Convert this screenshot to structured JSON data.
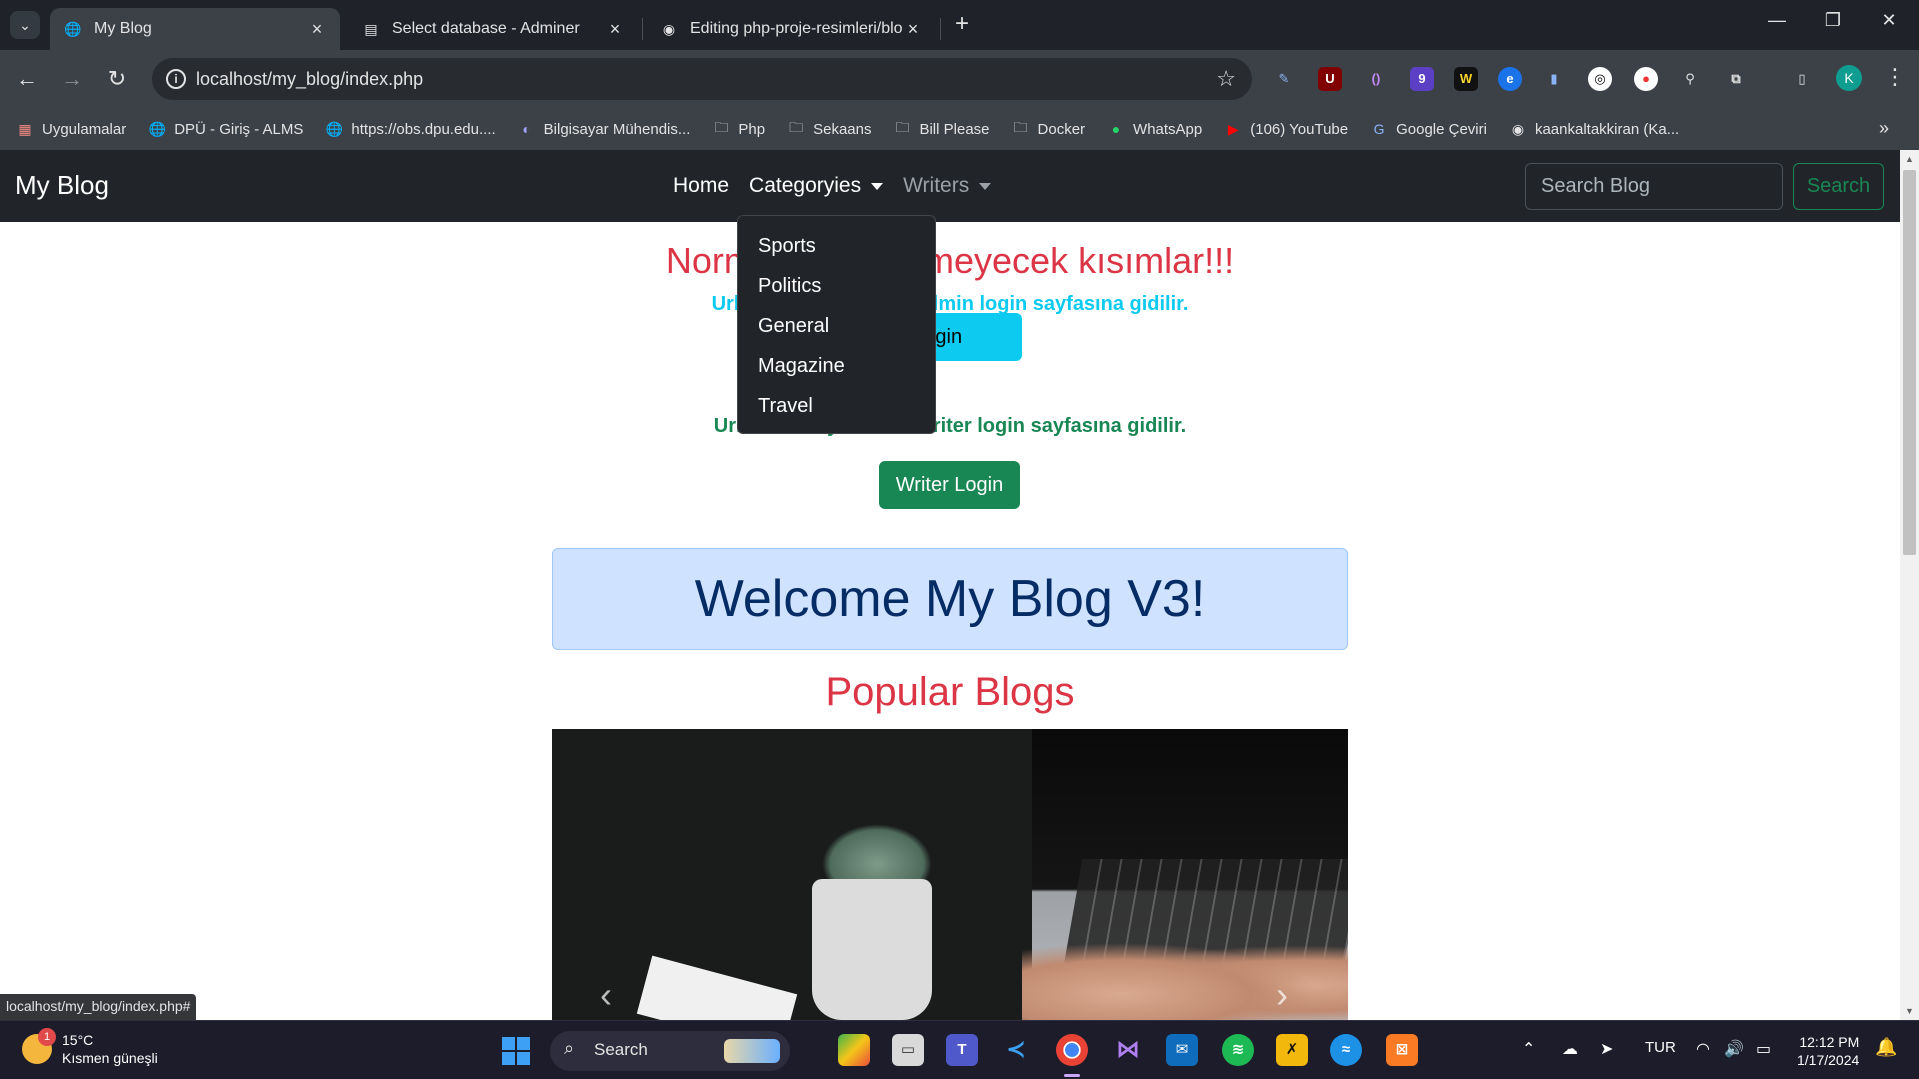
{
  "browser": {
    "tabs": [
      {
        "title": "My Blog",
        "active": true
      },
      {
        "title": "Select database - Adminer",
        "active": false
      },
      {
        "title": "Editing php-proje-resimleri/blo",
        "active": false
      }
    ],
    "url": "localhost/my_blog/index.php",
    "bookmarks": [
      {
        "label": "Uygulamalar",
        "icon": "apps-grid-icon"
      },
      {
        "label": "DPÜ - Giriş - ALMS",
        "icon": "globe-icon"
      },
      {
        "label": "https://obs.dpu.edu....",
        "icon": "globe-icon"
      },
      {
        "label": "Bilgisayar Mühendis...",
        "icon": "site-icon"
      },
      {
        "label": "Php",
        "icon": "folder-icon"
      },
      {
        "label": "Sekaans",
        "icon": "folder-icon"
      },
      {
        "label": "Bill Please",
        "icon": "folder-icon"
      },
      {
        "label": "Docker",
        "icon": "folder-icon"
      },
      {
        "label": "WhatsApp",
        "icon": "whatsapp-icon"
      },
      {
        "label": "(106) YouTube",
        "icon": "youtube-icon"
      },
      {
        "label": "Google Çeviri",
        "icon": "translate-icon"
      },
      {
        "label": "kaankaltakkiran (Ka...",
        "icon": "github-icon"
      }
    ],
    "profile_initial": "K",
    "extension_badge": "9",
    "status_url": "localhost/my_blog/index.php#"
  },
  "site": {
    "brand": "My Blog",
    "nav": {
      "home": "Home",
      "categories": "Categoryies",
      "writers": "Writers"
    },
    "search_placeholder": "Search Blog",
    "search_button": "Search",
    "dropdown_items": [
      "Sports",
      "Politics",
      "General",
      "Magazine",
      "Travel"
    ],
    "warning_heading": "Normalde görünmeyecek kısımlar!!!",
    "admin_hint": "Url kısmına yazılarak admin login sayfasına gidilir.",
    "admin_button": "Admin Login",
    "writer_hint": "Url kısmına yazılarak writer login sayfasına gidilir.",
    "writer_button": "Writer Login",
    "welcome": "Welcome My Blog V3!",
    "popular": "Popular Blogs",
    "colors": {
      "danger": "#dc3545",
      "info": "#0dcaf0",
      "success": "#198754",
      "navbar": "#212529"
    }
  },
  "taskbar": {
    "weather_temp": "15°C",
    "weather_desc": "Kısmen güneşli",
    "weather_badge": "1",
    "search": "Search",
    "lang": "TUR",
    "time": "12:12 PM",
    "date": "1/17/2024"
  }
}
